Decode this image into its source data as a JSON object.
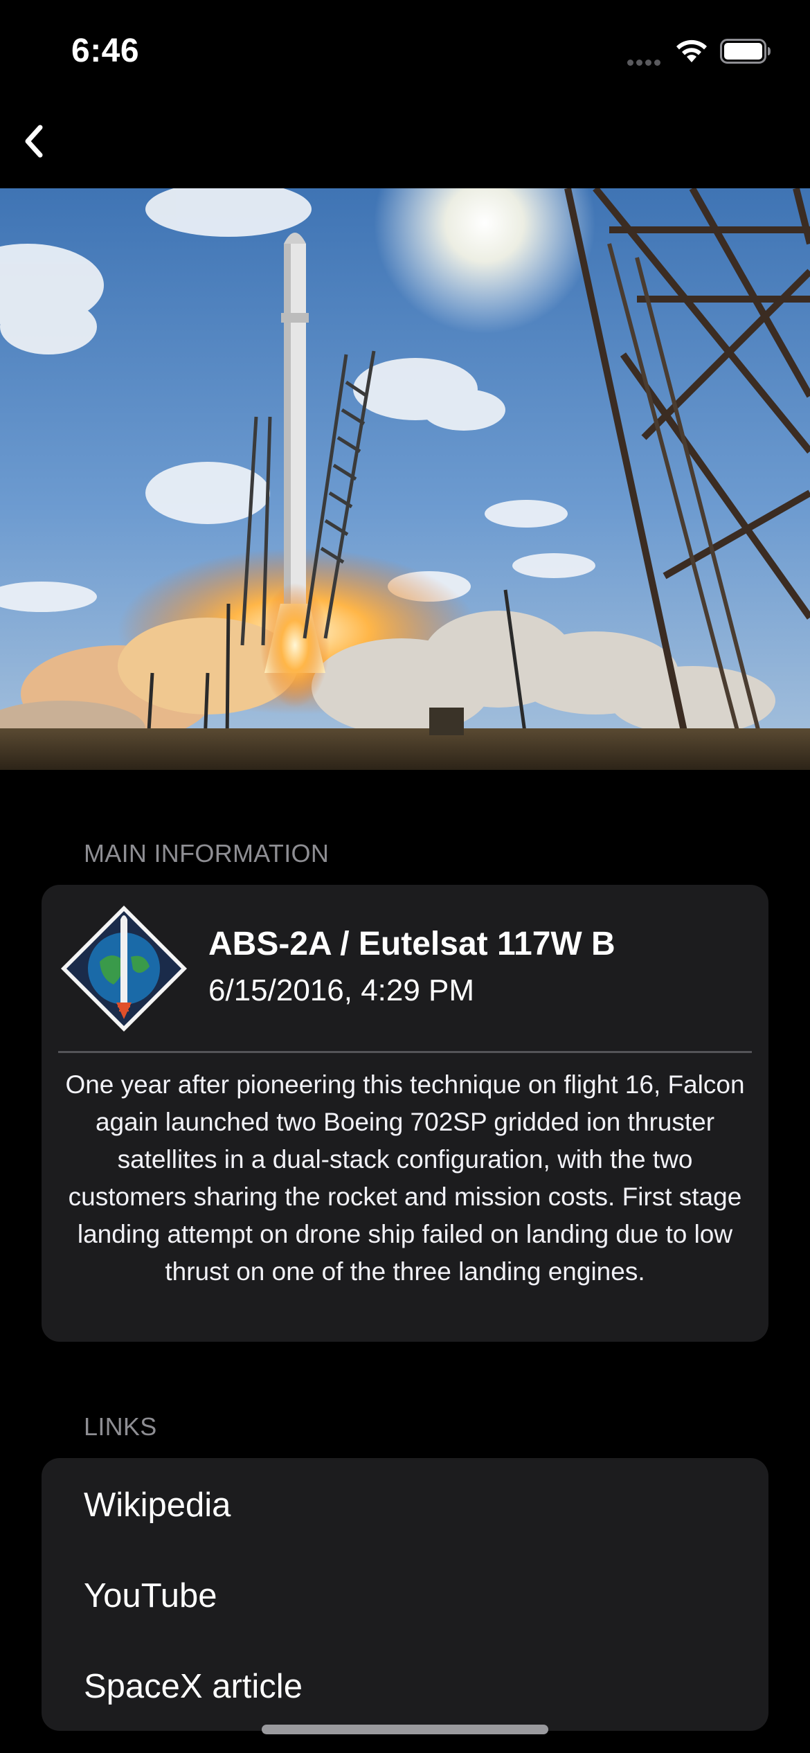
{
  "status_bar": {
    "time": "6:46"
  },
  "mission": {
    "name": "ABS-2A / Eutelsat 117W B",
    "date": "6/15/2016, 4:29 PM",
    "details": "One year after pioneering this technique on flight 16, Falcon again launched two Boeing 702SP gridded ion thruster satellites in a dual-stack configuration, with the two customers sharing the rocket and mission costs. First stage landing attempt on drone ship failed on landing due to low thrust on one of the three landing engines."
  },
  "sections": {
    "main_information": "MAIN INFORMATION",
    "links": "LINKS"
  },
  "links": [
    {
      "label": "Wikipedia"
    },
    {
      "label": "YouTube"
    },
    {
      "label": "SpaceX article"
    }
  ],
  "colors": {
    "background": "#000000",
    "card": "#1c1c1e",
    "secondary_text": "#8e8e93"
  }
}
